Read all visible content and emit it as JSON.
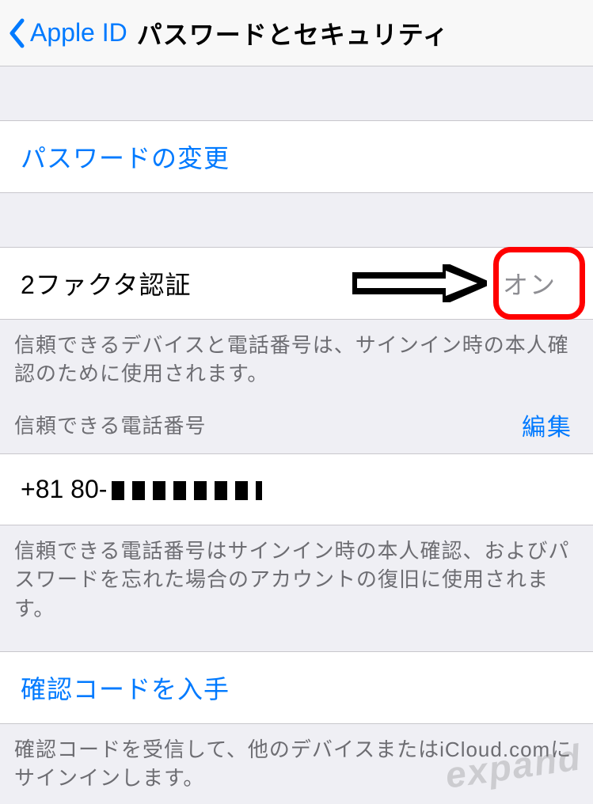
{
  "nav": {
    "back_label": "Apple ID",
    "title": "パスワードとセキュリティ"
  },
  "password_section": {
    "change_password": "パスワードの変更"
  },
  "two_factor": {
    "label": "2ファクタ認証",
    "value": "オン",
    "footer": "信頼できるデバイスと電話番号は、サインイン時の本人確認のために使用されます。"
  },
  "trusted_phone": {
    "header_label": "信頼できる電話番号",
    "header_action": "編集",
    "phone_prefix": "+81 80-",
    "footer": "信頼できる電話番号はサインイン時の本人確認、およびパスワードを忘れた場合のアカウントの復旧に使用されます。"
  },
  "verification_code": {
    "label": "確認コードを入手",
    "footer": "確認コードを受信して、他のデバイスまたはiCloud.comにサインインします。"
  },
  "watermark": "expand"
}
